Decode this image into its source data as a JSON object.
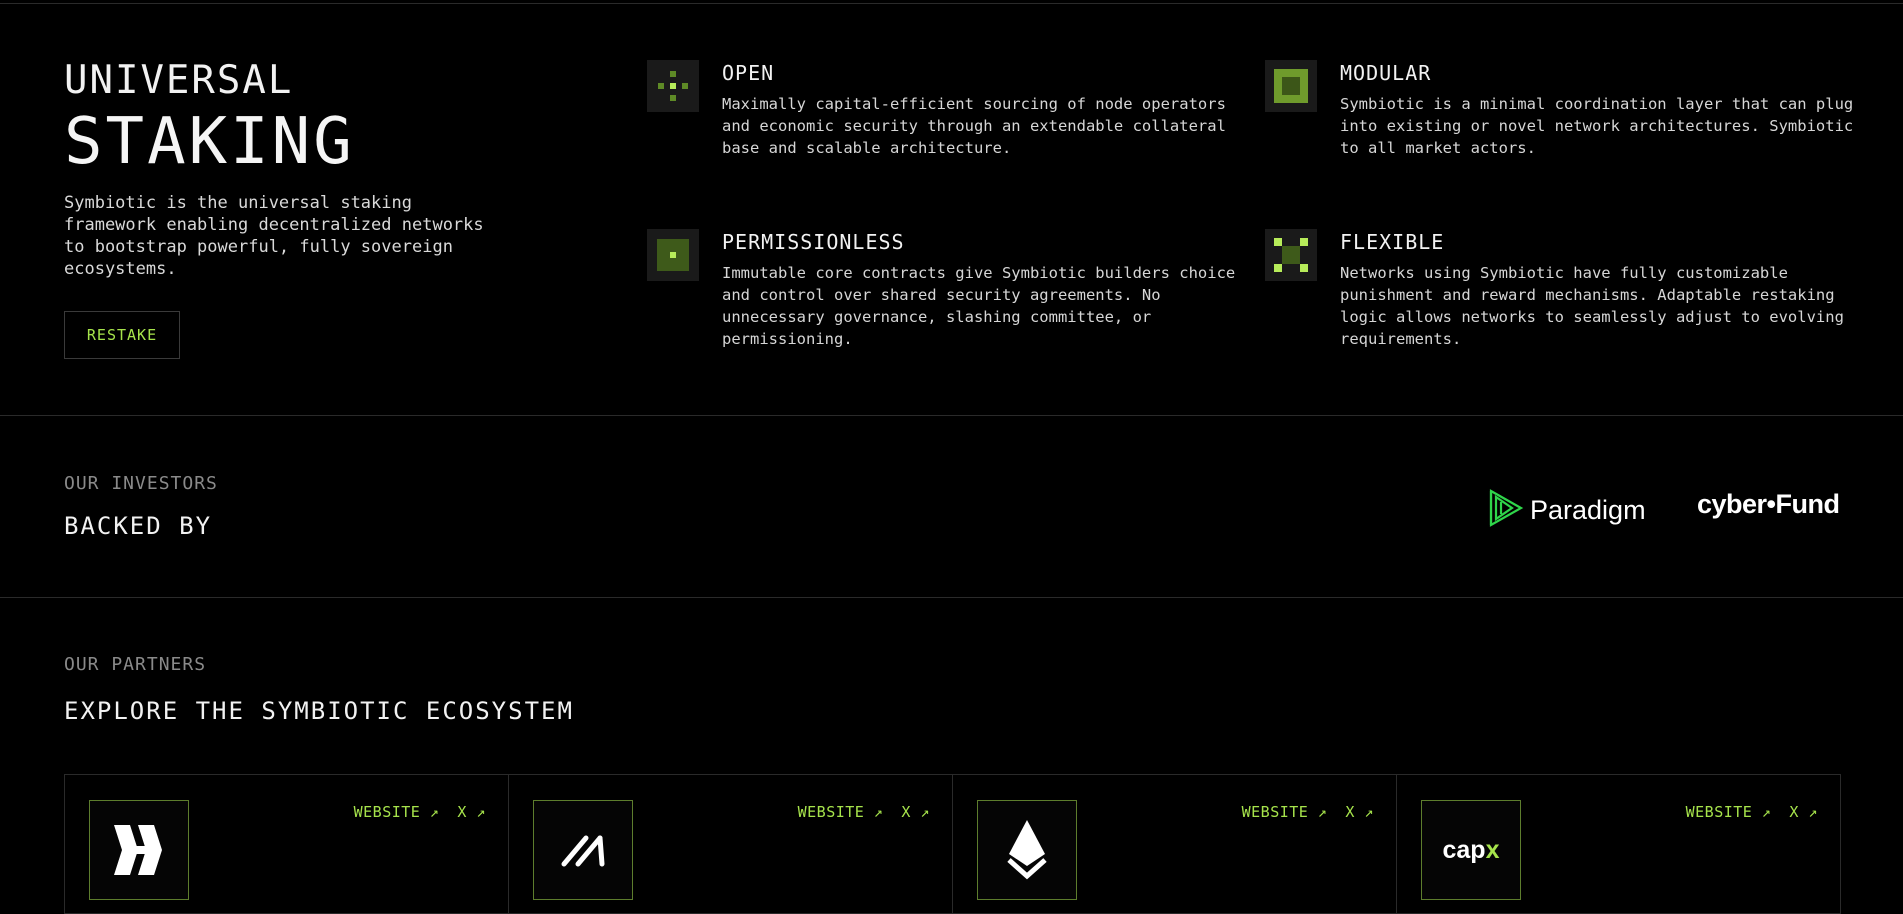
{
  "hero": {
    "title_line1": "UNIVERSAL",
    "title_line2": "STAKING",
    "description": "Symbiotic is the universal staking framework enabling decentralized networks to bootstrap powerful, fully sovereign ecosystems.",
    "cta_label": "RESTAKE"
  },
  "features": [
    {
      "icon": "open-pixel-icon",
      "title": "OPEN",
      "description": "Maximally capital-efficient sourcing of node operators and economic security through an extendable collateral base and scalable architecture."
    },
    {
      "icon": "modular-pixel-icon",
      "title": "MODULAR",
      "description": "Symbiotic is a minimal coordination layer that can plug into existing or novel network architectures. Symbiotic to all market actors."
    },
    {
      "icon": "permissionless-pixel-icon",
      "title": "PERMISSIONLESS",
      "description": "Immutable core contracts give Symbiotic builders choice and control over shared security agreements. No unnecessary governance, slashing committee, or permissioning."
    },
    {
      "icon": "flexible-pixel-icon",
      "title": "FLEXIBLE",
      "description": "Networks using Symbiotic have fully customizable punishment and reward mechanisms. Adaptable restaking logic allows networks to seamlessly adjust to evolving requirements."
    }
  ],
  "investors": {
    "kicker": "OUR INVESTORS",
    "heading": "BACKED BY",
    "logos": [
      {
        "name": "Paradigm",
        "icon": "paradigm-logo-icon"
      },
      {
        "name": "cyber•Fund",
        "icon": "cyberfund-logo-icon"
      }
    ]
  },
  "partners": {
    "kicker": "OUR PARTNERS",
    "heading": "EXPLORE THE SYMBIOTIC ECOSYSTEM",
    "website_label": "WEBSITE ↗",
    "x_label": "X ↗",
    "cards": [
      {
        "logo": "hyperlane-logo-icon"
      },
      {
        "logo": "slash-logo-icon"
      },
      {
        "logo": "drop-logo-icon"
      },
      {
        "logo": "capx-logo-icon",
        "logo_text_main": "cap",
        "logo_text_accent": "x"
      }
    ]
  },
  "colors": {
    "background": "#000000",
    "accent": "#a6e34b",
    "paradigm_green": "#2fd54a",
    "divider": "#2a2a2a"
  }
}
